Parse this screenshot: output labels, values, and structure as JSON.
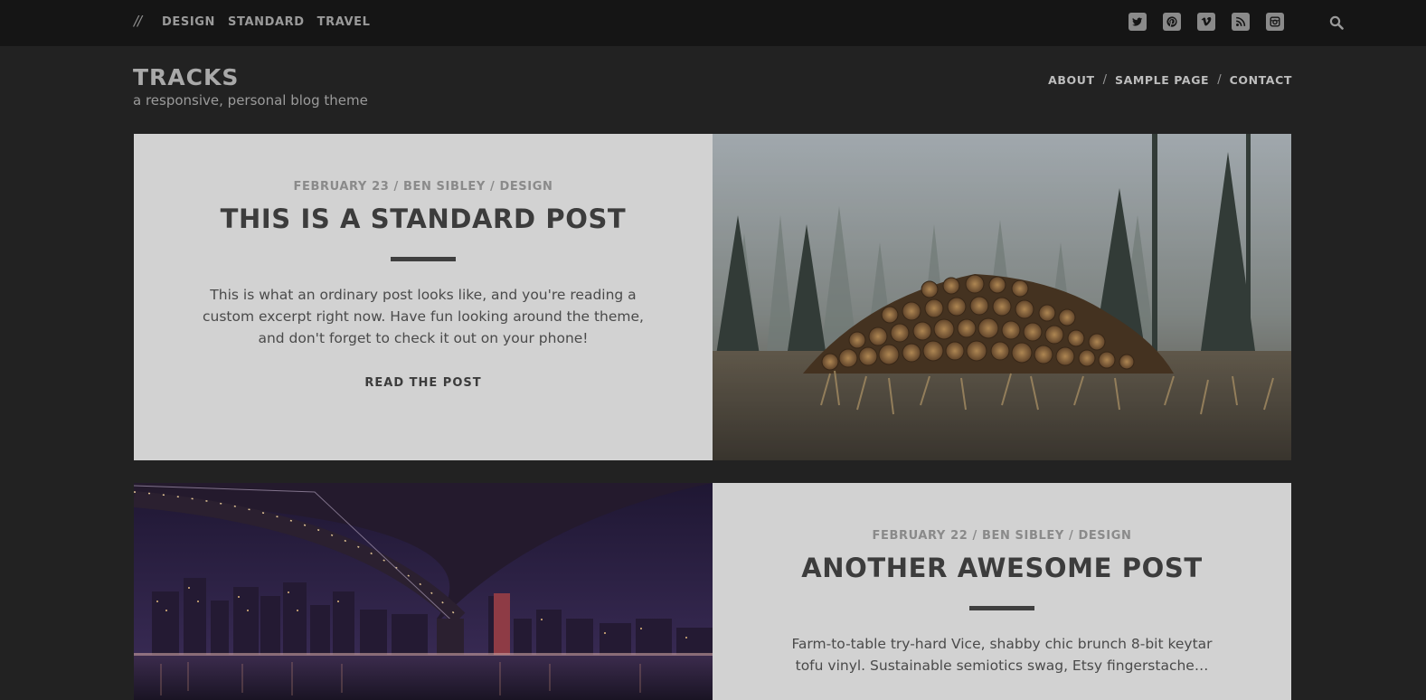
{
  "topbar": {
    "slashes": "//",
    "categories": [
      "DESIGN",
      "STANDARD",
      "TRAVEL"
    ],
    "social_icons": [
      "twitter-icon",
      "pinterest-icon",
      "vimeo-icon",
      "rss-icon",
      "instagram-icon"
    ],
    "search_icon": "search-icon"
  },
  "header": {
    "title": "TRACKS",
    "tagline": "a responsive, personal blog theme",
    "nav": [
      "ABOUT",
      "SAMPLE PAGE",
      "CONTACT"
    ],
    "nav_separator": "/"
  },
  "posts": [
    {
      "meta": "FEBRUARY 23 / BEN SIBLEY / DESIGN",
      "title": "THIS IS A STANDARD POST",
      "excerpt": "This is what an ordinary post looks like, and you're reading a custom excerpt right now. Have fun looking around the theme, and don't forget to check it out on your phone!",
      "read_more": "READ THE POST",
      "image": "forest-log-pile"
    },
    {
      "meta": "FEBRUARY 22 / BEN SIBLEY / DESIGN",
      "title": "ANOTHER AWESOME POST",
      "excerpt": "Farm-to-table try-hard Vice, shabby chic brunch 8-bit keytar tofu vinyl. Sustainable semiotics swag, Etsy fingerstache…",
      "image": "bridge-city-night"
    }
  ],
  "colors": {
    "background": "#222222",
    "topbar": "#151515",
    "panel": "#d2d2d2",
    "title_text": "#3c3c3c"
  }
}
